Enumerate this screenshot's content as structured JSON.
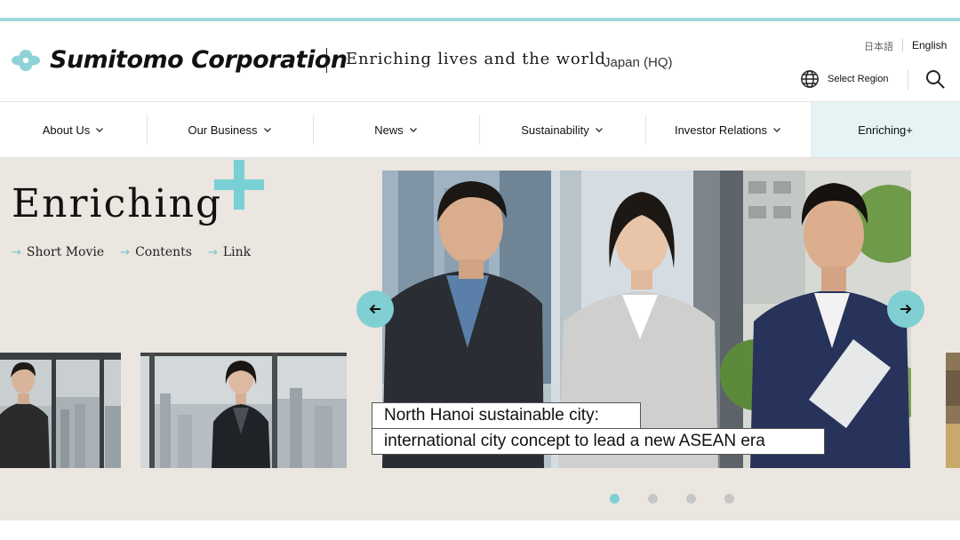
{
  "header": {
    "brand": "Sumitomo Corporation",
    "tagline": "Enriching lives and the world",
    "region": "Japan (HQ)",
    "lang_ja": "日本語",
    "lang_en": "English",
    "select_region": "Select Region"
  },
  "nav": {
    "items": [
      {
        "label": "About Us"
      },
      {
        "label": "Our Business"
      },
      {
        "label": "News"
      },
      {
        "label": "Sustainability"
      },
      {
        "label": "Investor Relations"
      },
      {
        "label": "Enriching+"
      }
    ]
  },
  "hero": {
    "title": "Enriching",
    "links": [
      "Short Movie",
      "Contents",
      "Link"
    ],
    "caption_line1": "North Hanoi sustainable city:",
    "caption_line2": "international city concept to lead a new ASEAN era",
    "total_slides": 4,
    "active_slide": 1
  },
  "colors": {
    "accent": "#7fcfd3",
    "stripe": "#9fd8dc",
    "hero_bg": "#ebe6e0",
    "nav_special_bg": "#e5f3f4"
  },
  "icons": {
    "logo": "sumitomo-logo-mark",
    "globe": "globe-icon",
    "search": "search-icon",
    "chevron": "chevron-down-icon",
    "prev": "arrow-left-icon",
    "next": "arrow-right-icon"
  }
}
